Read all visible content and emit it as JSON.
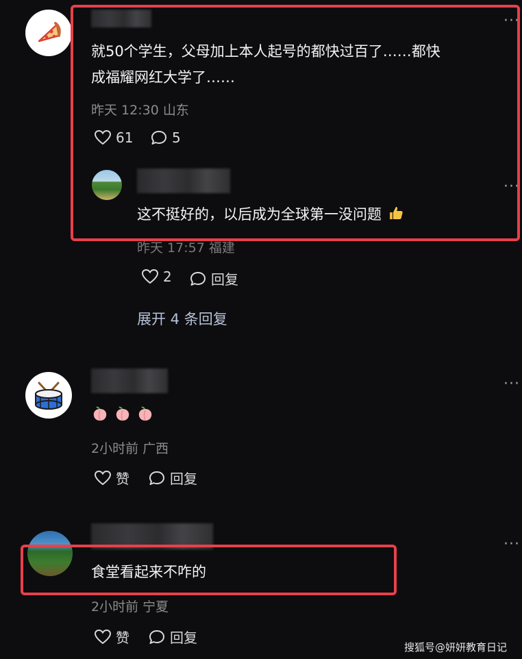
{
  "comments": [
    {
      "text": "就50个学生，父母加上本人起号的都快过百了……都快成福耀网红大学了……",
      "text_line1": "就50个学生，父母加上本人起号的都快过百了……都快",
      "text_line2": "成福耀网红大学了……",
      "meta": "昨天 12:30 山东",
      "likes": "61",
      "replies": "5",
      "avatar_icon": "pizza-icon",
      "reply": {
        "text": "这不挺好的，以后成为全球第一没问题",
        "meta": "昨天 17:57 福建",
        "likes": "2",
        "reply_label": "回复"
      },
      "expand_label": "展开 4 条回复"
    },
    {
      "emoji": "peach-icon",
      "meta": "2小时前 广西",
      "like_label": "赞",
      "reply_label": "回复",
      "avatar_icon": "drum-icon"
    },
    {
      "text": "食堂看起来不咋的",
      "meta": "2小时前 宁夏",
      "like_label": "赞",
      "reply_label": "回复"
    }
  ],
  "more_label": "···",
  "watermark": "搜狐号@妍妍教育日记",
  "colors": {
    "highlight": "#e8404a",
    "background": "#0d0d0f",
    "meta": "#8c8c8c",
    "link": "#b7c2d8"
  }
}
